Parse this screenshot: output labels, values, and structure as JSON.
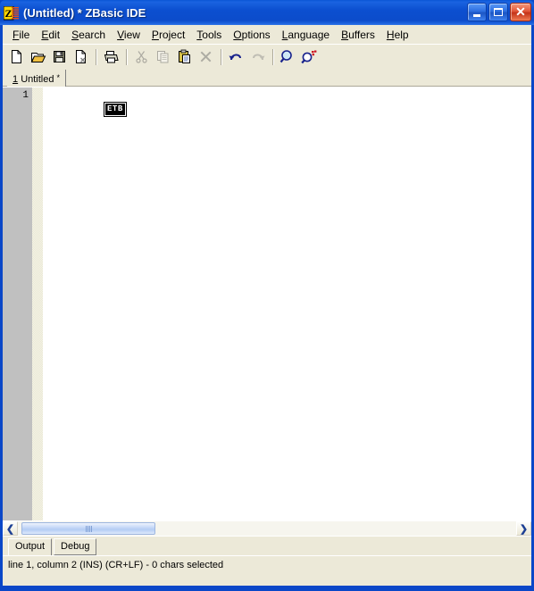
{
  "window": {
    "title": "(Untitled) * ZBasic IDE",
    "icon": "zbasic-app-icon",
    "buttons": {
      "minimize": "minimize-button",
      "maximize": "maximize-button",
      "close": "close-button",
      "close_glyph": "✕"
    }
  },
  "menu": {
    "items": [
      {
        "accel": "F",
        "rest": "ile"
      },
      {
        "accel": "E",
        "rest": "dit"
      },
      {
        "accel": "S",
        "rest": "earch"
      },
      {
        "accel": "V",
        "rest": "iew"
      },
      {
        "accel": "P",
        "rest": "roject"
      },
      {
        "accel": "T",
        "rest": "ools"
      },
      {
        "accel": "O",
        "rest": "ptions"
      },
      {
        "accel": "L",
        "rest": "anguage"
      },
      {
        "accel": "B",
        "rest": "uffers"
      },
      {
        "accel": "H",
        "rest": "elp"
      }
    ]
  },
  "toolbar": {
    "buttons": [
      {
        "name": "new-file-button",
        "icon": "new-document-icon",
        "enabled": true
      },
      {
        "name": "open-file-button",
        "icon": "open-folder-icon",
        "enabled": true
      },
      {
        "name": "save-file-button",
        "icon": "floppy-save-icon",
        "enabled": true
      },
      {
        "name": "close-file-button",
        "icon": "document-close-icon",
        "enabled": true
      },
      {
        "name": "print-button",
        "icon": "printer-icon",
        "enabled": true
      },
      {
        "name": "cut-button",
        "icon": "scissors-icon",
        "enabled": false
      },
      {
        "name": "copy-button",
        "icon": "copy-pages-icon",
        "enabled": false
      },
      {
        "name": "paste-button",
        "icon": "clipboard-paste-icon",
        "enabled": true
      },
      {
        "name": "delete-button",
        "icon": "x-delete-icon",
        "enabled": false
      },
      {
        "name": "undo-button",
        "icon": "undo-arrow-icon",
        "enabled": true
      },
      {
        "name": "redo-button",
        "icon": "redo-arrow-icon",
        "enabled": false
      },
      {
        "name": "find-button",
        "icon": "magnifier-icon",
        "enabled": true
      },
      {
        "name": "find-replace-button",
        "icon": "magnifier-replace-icon",
        "enabled": true
      }
    ]
  },
  "doc_tabs": [
    {
      "number": "1",
      "label": "Untitled",
      "modified": "*"
    }
  ],
  "editor": {
    "lines": [
      {
        "number": "1",
        "control_glyph": "ETB"
      }
    ],
    "gutter_color": "#c0c0c0",
    "background_color": "#ffffff"
  },
  "hscroll": {
    "left_arrow": "❮",
    "right_arrow": "❯",
    "thumb_name": "hscroll-thumb"
  },
  "bottom_tabs": [
    {
      "label": "Output",
      "active": true
    },
    {
      "label": "Debug",
      "active": false
    }
  ],
  "statusbar": {
    "text": "line 1, column 2 (INS) (CR+LF)  -  0 chars selected"
  },
  "colors": {
    "title_blue": "#0c4ccb",
    "face": "#ece9d8",
    "gutter": "#c0c0c0",
    "frame_blue": "#0a47c8"
  }
}
